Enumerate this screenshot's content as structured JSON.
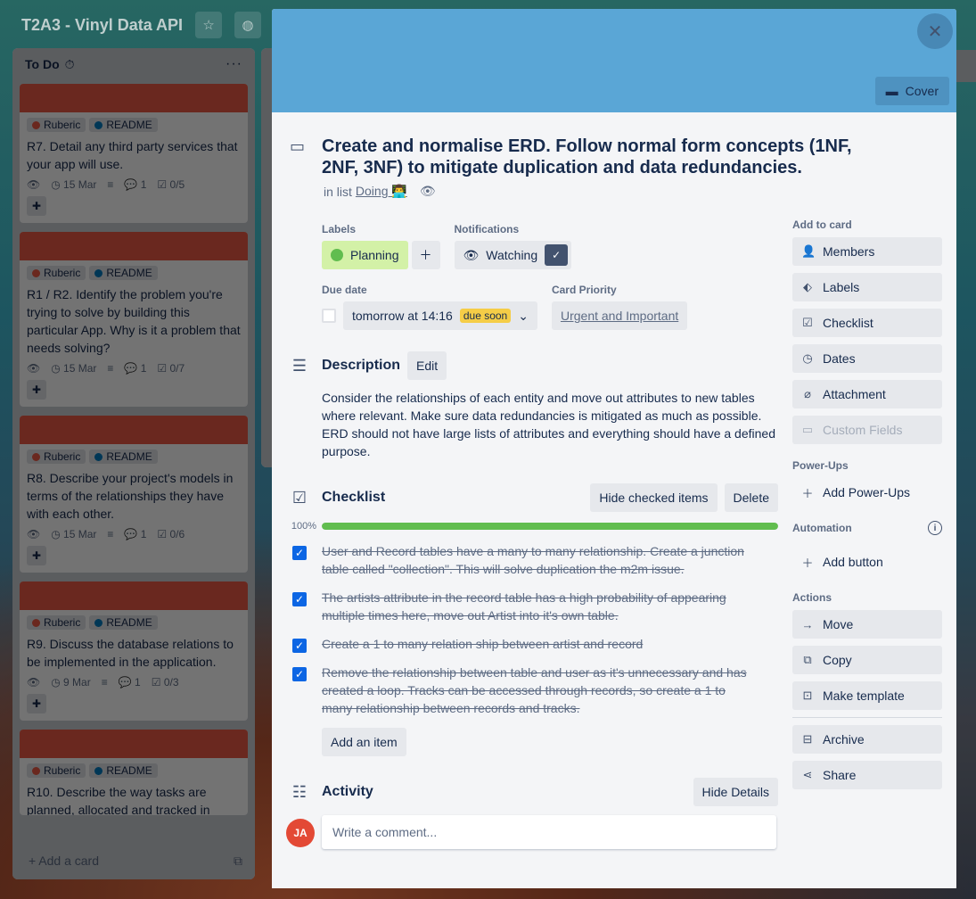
{
  "board": {
    "title": "T2A3 - Vinyl Data API"
  },
  "list": {
    "title": "To Do",
    "add_card": "+ Add a card",
    "cards": [
      {
        "labels": [
          "Ruberic",
          "README"
        ],
        "text": "R7. Detail any third party services that your app will use.",
        "due": "15 Mar",
        "comments": "1",
        "checklist": "0/5"
      },
      {
        "labels": [
          "Ruberic",
          "README"
        ],
        "text": "R1 / R2. Identify the problem you're trying to solve by building this particular App. Why is it a problem that needs solving?",
        "due": "15 Mar",
        "comments": "1",
        "checklist": "0/7"
      },
      {
        "labels": [
          "Ruberic",
          "README"
        ],
        "text": "R8. Describe your project's models in terms of the relationships they have with each other.",
        "due": "15 Mar",
        "comments": "1",
        "checklist": "0/6"
      },
      {
        "labels": [
          "Ruberic",
          "README"
        ],
        "text": "R9. Discuss the database relations to be implemented in the application.",
        "due": "9 Mar",
        "comments": "1",
        "checklist": "0/3"
      },
      {
        "labels": [
          "Ruberic",
          "README"
        ],
        "text": "R10. Describe the way tasks are planned, allocated and tracked in"
      }
    ]
  },
  "modal": {
    "cover_button": "Cover",
    "title": "Create and normalise ERD. Follow normal form concepts (1NF, 2NF, 3NF) to mitigate duplication and data redundancies.",
    "in_list_prefix": "in list",
    "list_name": "Doing 👨‍💻",
    "labels_heading": "Labels",
    "label_name": "Planning",
    "notifications_heading": "Notifications",
    "watching": "Watching",
    "due_heading": "Due date",
    "due_text": "tomorrow at 14:16",
    "due_badge": "due soon",
    "priority_heading": "Card Priority",
    "priority_value": "Urgent and Important",
    "description_heading": "Description",
    "edit_button": "Edit",
    "description": "Consider the relationships of each entity and move out attributes to new tables where relevant. Make sure data redundancies is mitigated as much as possible. ERD should not have large lists of attributes and everything should have a defined purpose.",
    "checklist_heading": "Checklist",
    "hide_checked": "Hide checked items",
    "delete": "Delete",
    "progress_label": "100%",
    "progress": 1.0,
    "checklist_items": [
      "User and Record tables have a many to many relationship. Create a junction table called \"collection\". This will solve duplication the m2m issue.",
      "The artists attribute in the record table has a high probability of appearing multiple times here, move out Artist into it's own table.",
      "Create a 1 to many relation ship between artist and record",
      "Remove the relationship between table and user as it's unnecessary and has created a loop. Tracks can be accessed through records, so create a 1 to many relationship between records and tracks."
    ],
    "add_item": "Add an item",
    "activity_heading": "Activity",
    "hide_details": "Hide Details",
    "avatar_initials": "JA",
    "comment_placeholder": "Write a comment..."
  },
  "sidebar": {
    "add_to_card": "Add to card",
    "add_items": [
      "Members",
      "Labels",
      "Checklist",
      "Dates",
      "Attachment",
      "Custom Fields"
    ],
    "powerups_heading": "Power-Ups",
    "add_powerups": "Add Power-Ups",
    "automation_heading": "Automation",
    "add_button": "Add button",
    "actions_heading": "Actions",
    "actions": [
      "Move",
      "Copy",
      "Make template"
    ],
    "archive": "Archive",
    "share": "Share"
  },
  "colors": {
    "cover": "#5aa6d6",
    "card_cover": "#eb5a46",
    "label_planning": "#61bd4f",
    "progress": "#61bd4f",
    "checkbox": "#0c66e4"
  }
}
